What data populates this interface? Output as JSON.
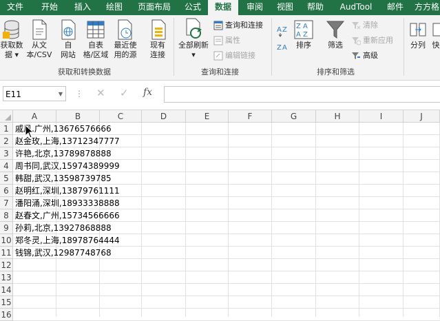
{
  "tabs": [
    "文件",
    "开始",
    "插入",
    "绘图",
    "页面布局",
    "公式",
    "数据",
    "审阅",
    "视图",
    "帮助",
    "AudTool",
    "邮件",
    "方方格"
  ],
  "active_tab": "数据",
  "ribbon": {
    "get_data": {
      "line1": "获取数",
      "line2": "据 ▾"
    },
    "from_csv": {
      "line1": "从文",
      "line2": "本/CSV"
    },
    "from_web": {
      "line1": "自",
      "line2": "网站"
    },
    "from_table": {
      "line1": "自表",
      "line2": "格/区域"
    },
    "recent": {
      "line1": "最近使",
      "line2": "用的源"
    },
    "existing": {
      "line1": "现有",
      "line2": "连接"
    },
    "group1_label": "获取和转换数据",
    "refresh_all": {
      "line1": "全部刷新",
      "line2": "▾"
    },
    "queries": "查询和连接",
    "properties": "属性",
    "edit_links": "编辑链接",
    "group2_label": "查询和连接",
    "sort": "排序",
    "filter": "筛选",
    "clear": "清除",
    "reapply": "重新应用",
    "advanced": "高级",
    "group3_label": "排序和筛选",
    "text_to_columns": "分列",
    "flash_fill": "快"
  },
  "formula_bar": {
    "name_box": "E11",
    "fx": "fx",
    "formula": ""
  },
  "columns": [
    "A",
    "B",
    "C",
    "D",
    "E",
    "F",
    "G",
    "H",
    "I",
    "J"
  ],
  "rows": [
    "1",
    "2",
    "3",
    "4",
    "5",
    "6",
    "7",
    "8",
    "9",
    "10",
    "11",
    "12",
    "13",
    "14",
    "15",
    "16"
  ],
  "cells": [
    "戚风,广州,13676576666",
    "赵金玫,上海,13712347777",
    "许艳,北京,13789878888",
    "周书同,武汉,15974389999",
    "韩甜,武汉,13598739785",
    "赵明红,深圳,13879761111",
    "潘阳涌,深圳,18933338888",
    "赵春文,广州,15734566666",
    "孙莉,北京,13927868888",
    "郑冬灵,上海,18978764444",
    "钱锦,武汉,12987748768"
  ],
  "colors": {
    "accent": "#217346"
  }
}
